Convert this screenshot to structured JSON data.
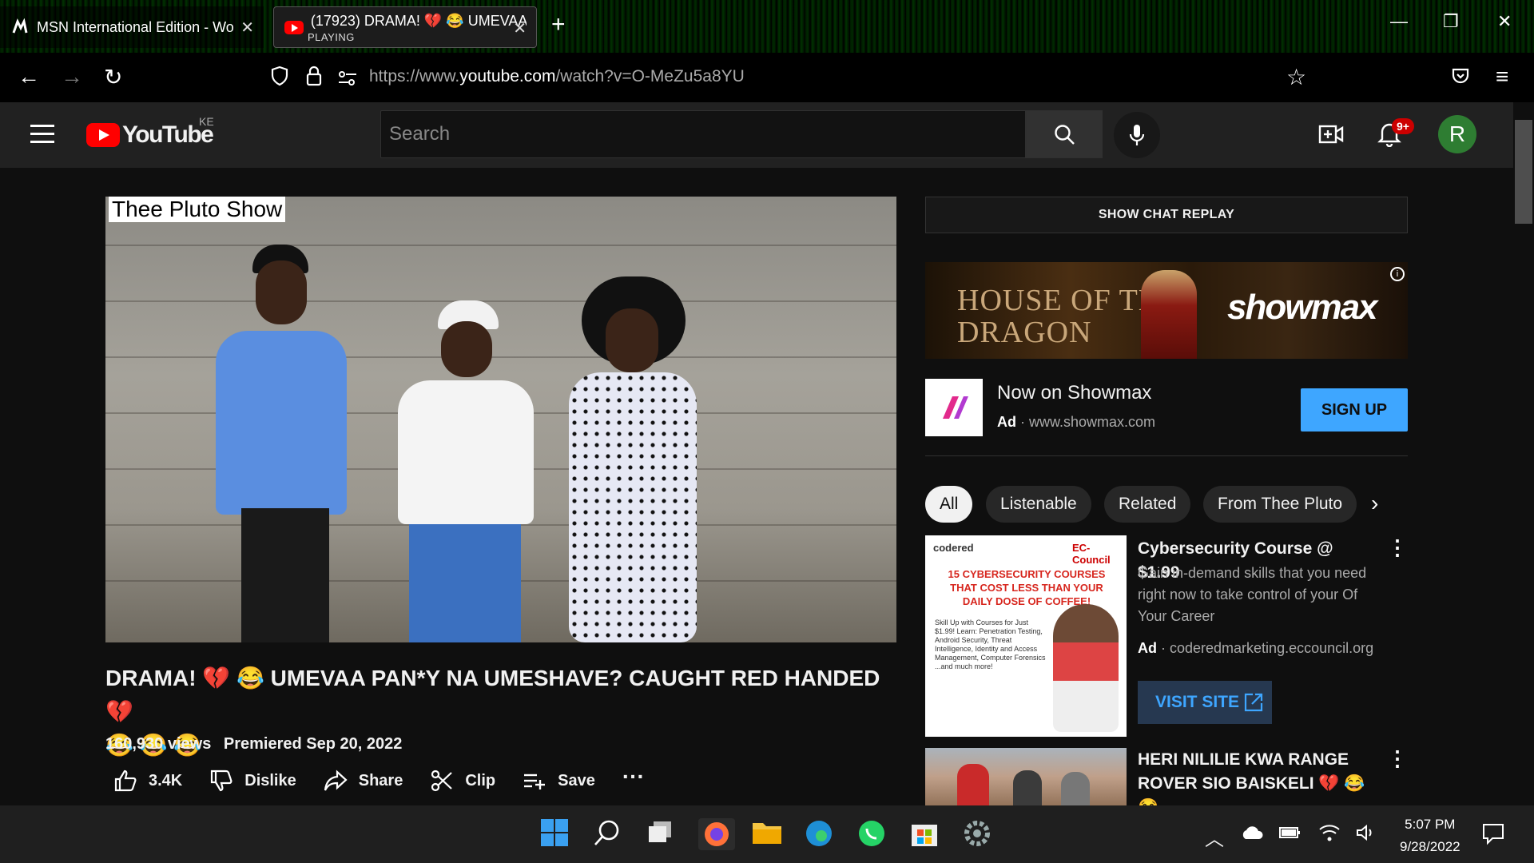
{
  "browser": {
    "tabs": [
      {
        "title": "MSN International Edition - Wo",
        "active": false
      },
      {
        "title": "(17923) DRAMA! 💔 😂 UMEVAA",
        "subtitle": "PLAYING",
        "active": true
      }
    ],
    "url_prefix": "https://www.",
    "url_domain": "youtube.com",
    "url_path": "/watch?v=O-MeZu5a8YU"
  },
  "youtube": {
    "logo": "YouTube",
    "country": "KE",
    "search_placeholder": "Search",
    "notification_count": "9+",
    "avatar_letter": "R"
  },
  "video": {
    "watermark": "Thee Pluto Show",
    "title_line1": "DRAMA! 💔 😂 UMEVAA PAN*Y NA UMESHAVE? CAUGHT RED HANDED 💔",
    "title_line2": "😂 😂 😂",
    "views": "160,930 views",
    "premiered": "Premiered Sep 20, 2022",
    "likes": "3.4K",
    "dislike_label": "Dislike",
    "share_label": "Share",
    "clip_label": "Clip",
    "save_label": "Save"
  },
  "sidebar": {
    "chat_replay": "SHOW CHAT REPLAY",
    "ad_banner": {
      "line1": "HOUSE OF THE",
      "line2": "DRAGON",
      "brand": "showmax"
    },
    "ad": {
      "title": "Now on Showmax",
      "label": "Ad",
      "domain": "www.showmax.com",
      "cta": "SIGN UP"
    },
    "chips": [
      "All",
      "Listenable",
      "Related",
      "From Thee Pluto"
    ],
    "card1": {
      "thumb_brand": "codered",
      "thumb_partner": "EC-Council",
      "thumb_headline": "15 CYBERSECURITY COURSES THAT COST LESS THAN YOUR DAILY DOSE OF COFFEE!",
      "thumb_body": "Skill Up with Courses for Just $1.99! Learn: Penetration Testing, Android Security, Threat Intelligence, Identity and Access Management, Computer Forensics ...and much more!",
      "title": "Cybersecurity Course @ $1.99",
      "description": "Gain in-demand skills that you need right now to take control of your Of Your Career",
      "label": "Ad",
      "domain": "coderedmarketing.eccouncil.org",
      "cta": "VISIT SITE"
    },
    "card2": {
      "title": "HERI NILILIE KWA RANGE ROVER SIO BAISKELI 💔 😂 😂 ..."
    }
  },
  "taskbar": {
    "time": "5:07 PM",
    "date": "9/28/2022"
  }
}
